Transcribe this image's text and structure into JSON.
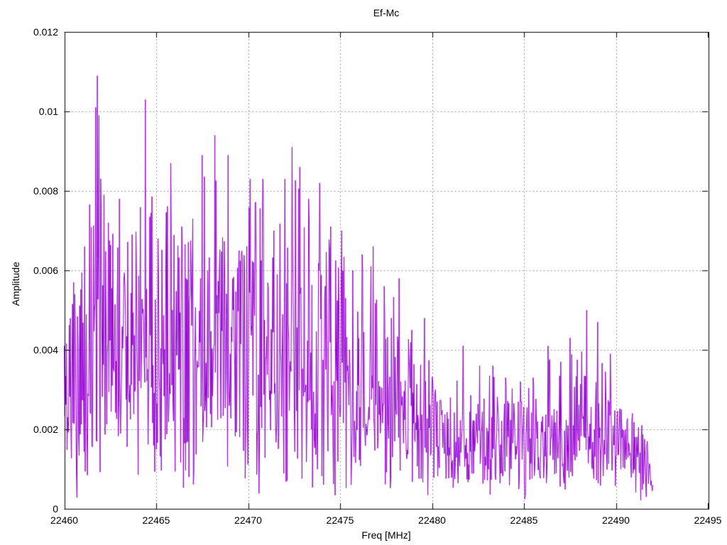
{
  "chart_data": {
    "type": "line",
    "title": "Ef-Mc",
    "xlabel": "Freq [MHz]",
    "ylabel": "Amplitude",
    "xlim": [
      22460,
      22495
    ],
    "ylim": [
      0,
      0.012
    ],
    "x_ticks": [
      22460,
      22465,
      22470,
      22475,
      22480,
      22485,
      22490,
      22495
    ],
    "x_tick_labels": [
      "22460",
      "22465",
      "22470",
      "22475",
      "22480",
      "22485",
      "22490",
      "22495"
    ],
    "y_ticks": [
      0,
      0.002,
      0.004,
      0.006,
      0.008,
      0.01,
      0.012
    ],
    "y_tick_labels": [
      "0",
      "0.002",
      "0.004",
      "0.006",
      "0.008",
      "0.01",
      "0.012"
    ],
    "grid": true,
    "grid_style": "dotted",
    "legend": "none",
    "series_name": "Ef-Mc",
    "line_color": "#9400d3",
    "grid_color": "#9c9c9c",
    "border_color": "#000000",
    "text_color": "#000000",
    "background_color": "#ffffff",
    "data_start_mhz": 22460.0,
    "data_end_mhz": 22492.0,
    "sample_step_mhz": 0.03,
    "noise_floor": 0.0002,
    "noise_seed": 20233,
    "envelope_keyframes_f_max_typ": [
      [
        22460.0,
        0.0041,
        0.0022
      ],
      [
        22460.5,
        0.0057,
        0.0028
      ],
      [
        22461.1,
        0.0066,
        0.0032
      ],
      [
        22461.7,
        0.0101,
        0.0044
      ],
      [
        22461.8,
        0.0109,
        0.0045
      ],
      [
        22461.9,
        0.0099,
        0.0042
      ],
      [
        22462.4,
        0.0072,
        0.0038
      ],
      [
        22463.0,
        0.0078,
        0.0038
      ],
      [
        22463.7,
        0.0069,
        0.0036
      ],
      [
        22464.4,
        0.0103,
        0.004
      ],
      [
        22465.1,
        0.0068,
        0.0036
      ],
      [
        22465.8,
        0.0087,
        0.0038
      ],
      [
        22466.4,
        0.0071,
        0.0036
      ],
      [
        22467.0,
        0.0073,
        0.0038
      ],
      [
        22467.5,
        0.0089,
        0.004
      ],
      [
        22468.2,
        0.0094,
        0.0042
      ],
      [
        22468.9,
        0.0089,
        0.004
      ],
      [
        22469.5,
        0.0065,
        0.0036
      ],
      [
        22470.1,
        0.0083,
        0.004
      ],
      [
        22470.8,
        0.0083,
        0.004
      ],
      [
        22471.4,
        0.007,
        0.0036
      ],
      [
        22472.0,
        0.0083,
        0.0038
      ],
      [
        22472.4,
        0.0091,
        0.004
      ],
      [
        22472.8,
        0.0086,
        0.0038
      ],
      [
        22473.3,
        0.0078,
        0.0036
      ],
      [
        22473.9,
        0.0082,
        0.0036
      ],
      [
        22474.5,
        0.0071,
        0.0034
      ],
      [
        22475.1,
        0.007,
        0.0032
      ],
      [
        22475.7,
        0.006,
        0.0028
      ],
      [
        22476.2,
        0.0064,
        0.0027
      ],
      [
        22476.8,
        0.0066,
        0.0026
      ],
      [
        22477.4,
        0.0056,
        0.0024
      ],
      [
        22478.2,
        0.0058,
        0.0024
      ],
      [
        22478.9,
        0.0045,
        0.0021
      ],
      [
        22479.6,
        0.0048,
        0.0019
      ],
      [
        22480.2,
        0.003,
        0.0015
      ],
      [
        22481.0,
        0.0028,
        0.0014
      ],
      [
        22481.7,
        0.0041,
        0.0015
      ],
      [
        22482.6,
        0.0036,
        0.0014
      ],
      [
        22483.3,
        0.0036,
        0.0015
      ],
      [
        22484.0,
        0.0033,
        0.0014
      ],
      [
        22484.8,
        0.0032,
        0.0014
      ],
      [
        22485.5,
        0.0033,
        0.0015
      ],
      [
        22486.3,
        0.0041,
        0.0016
      ],
      [
        22487.0,
        0.0037,
        0.0015
      ],
      [
        22487.5,
        0.0043,
        0.0016
      ],
      [
        22488.4,
        0.005,
        0.0017
      ],
      [
        22489.0,
        0.0047,
        0.0016
      ],
      [
        22489.7,
        0.0039,
        0.0015
      ],
      [
        22490.3,
        0.0025,
        0.0013
      ],
      [
        22490.9,
        0.0024,
        0.0012
      ],
      [
        22491.4,
        0.0021,
        0.0011
      ],
      [
        22491.7,
        0.0017,
        0.0009
      ],
      [
        22492.0,
        0.0006,
        0.0004
      ]
    ]
  }
}
